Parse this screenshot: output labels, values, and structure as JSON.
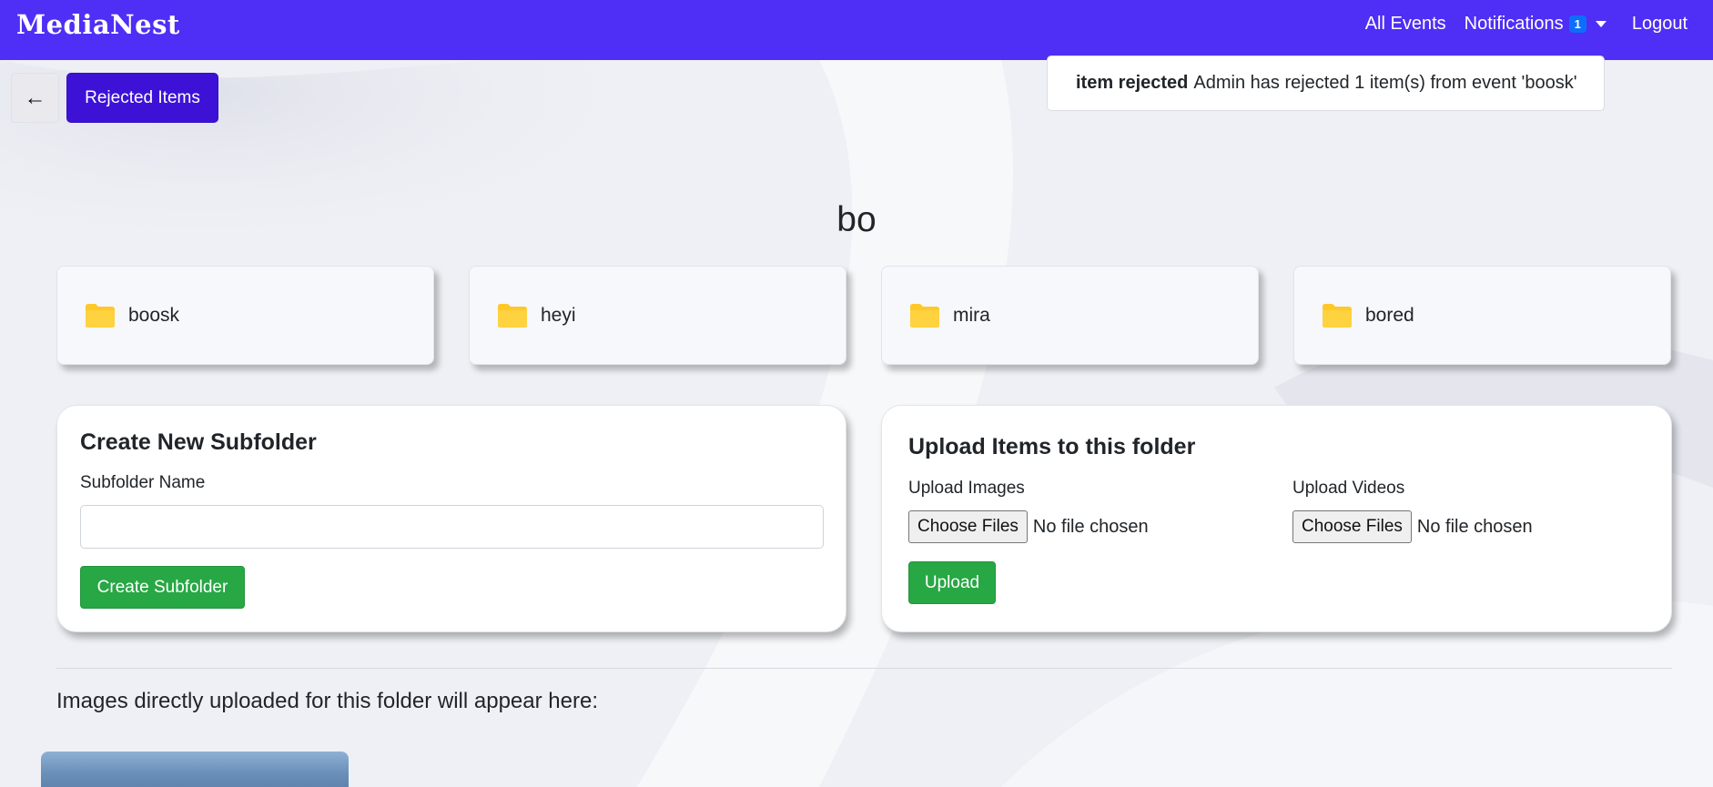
{
  "navbar": {
    "brand": "MediaNest",
    "links": {
      "all_events": "All Events",
      "notifications": "Notifications",
      "notifications_count": "1",
      "logout": "Logout"
    },
    "background_color": "#4f2ef5"
  },
  "toolbar": {
    "back_label": "←",
    "rejected_label": "Rejected Items"
  },
  "toast": {
    "title": "item rejected",
    "message": "Admin has rejected 1 item(s) from event 'boosk'"
  },
  "page": {
    "folder_title": "bo"
  },
  "subfolders": [
    {
      "name": "boosk",
      "icon": "folder-icon"
    },
    {
      "name": "heyi",
      "icon": "folder-icon"
    },
    {
      "name": "mira",
      "icon": "folder-icon"
    },
    {
      "name": "bored",
      "icon": "folder-icon"
    }
  ],
  "create_subfolder": {
    "title": "Create New Subfolder",
    "field_label": "Subfolder Name",
    "field_value": "",
    "button_label": "Create Subfolder"
  },
  "upload": {
    "title": "Upload Items to this folder",
    "images_label": "Upload Images",
    "videos_label": "Upload Videos",
    "choose_label": "Choose Files",
    "no_file_text": "No file chosen",
    "button_label": "Upload"
  },
  "images_section": {
    "note": "Images directly uploaded for this folder will appear here:"
  },
  "colors": {
    "primary": "#4f2ef5",
    "rejected_button": "#3d12d6",
    "success": "#28a745",
    "folder": "#ffc828",
    "badge": "#0d6efd"
  }
}
